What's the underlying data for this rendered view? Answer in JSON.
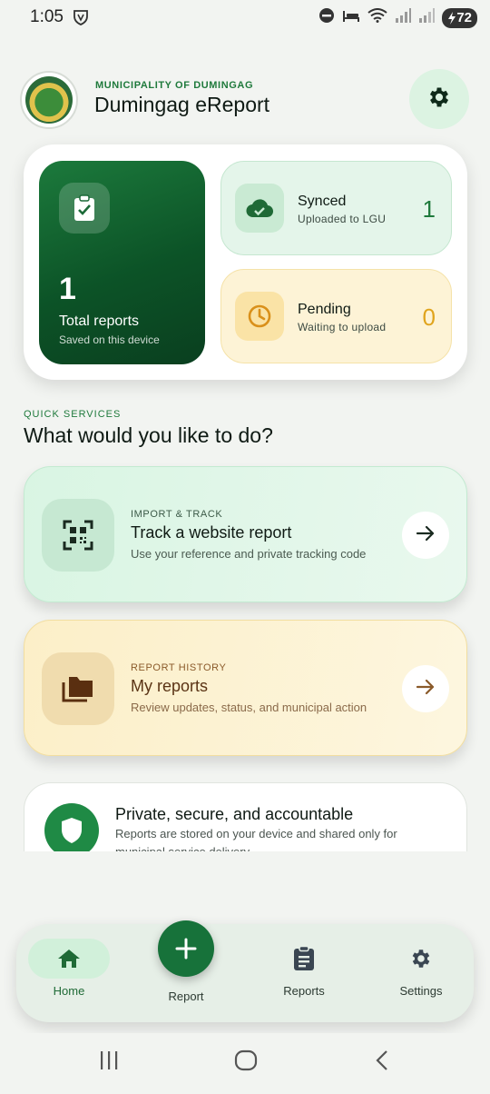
{
  "status_bar": {
    "time": "1:05",
    "battery": "72"
  },
  "header": {
    "municipality": "MUNICIPALITY OF DUMINGAG",
    "app_name": "Dumingag eReport"
  },
  "stats": {
    "total": {
      "value": "1",
      "label": "Total reports",
      "sub": "Saved on this device"
    },
    "synced": {
      "title": "Synced",
      "sub": "Uploaded to LGU",
      "value": "1"
    },
    "pending": {
      "title": "Pending",
      "sub": "Waiting to upload",
      "value": "0"
    }
  },
  "quick_services": {
    "label": "QUICK SERVICES",
    "title": "What would you like to do?"
  },
  "actions": [
    {
      "kicker": "IMPORT & TRACK",
      "title": "Track a website report",
      "sub": "Use your reference and private tracking code"
    },
    {
      "kicker": "REPORT HISTORY",
      "title": "My reports",
      "sub": "Review updates, status, and municipal action"
    }
  ],
  "privacy": {
    "title": "Private, secure, and accountable",
    "body": "Reports are stored on your device and shared only for municipal service delivery."
  },
  "nav": {
    "home": "Home",
    "report": "Report",
    "reports": "Reports",
    "settings": "Settings"
  },
  "colors": {
    "brand_green": "#17723a",
    "synced_green": "#1f7a3c",
    "pending_amber": "#e0a41d"
  }
}
